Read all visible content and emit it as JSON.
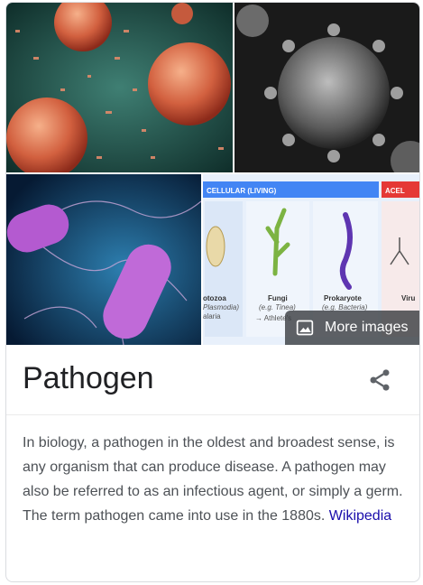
{
  "images": [
    {
      "name": "coronavirus-red-particles"
    },
    {
      "name": "coronavirus-grayscale"
    },
    {
      "name": "bacteria-purple-flagella"
    },
    {
      "name": "cellular-living-chart"
    }
  ],
  "chart_image": {
    "header_left": "CELLULAR (LIVING)",
    "header_right": "ACEL",
    "columns": [
      {
        "title": "otozoa",
        "sub1": "Plasmodia)",
        "sub2": "alaria"
      },
      {
        "title": "Fungi",
        "sub1": "(e.g. Tinea)",
        "sub2": "→ Athlete's"
      },
      {
        "title": "Prokaryote",
        "sub1": "(e.g. Bacteria)",
        "sub2": ""
      },
      {
        "title": "Viru",
        "sub1": "",
        "sub2": ""
      }
    ]
  },
  "more_images": {
    "label": "More images",
    "icon": "image-icon"
  },
  "title": "Pathogen",
  "share_icon": "share-icon",
  "description": {
    "text": "In biology, a pathogen in the oldest and broadest sense, is any organism that can produce disease. A pathogen may also be referred to as an infectious agent, or simply a germ. The term pathogen came into use in the 1880s.",
    "source_link": "Wikipedia"
  },
  "colors": {
    "link": "#1a0dab",
    "text": "#4d5156",
    "title": "#202124",
    "chart_header_blue": "#4285f4",
    "chart_header_red": "#e53935"
  }
}
